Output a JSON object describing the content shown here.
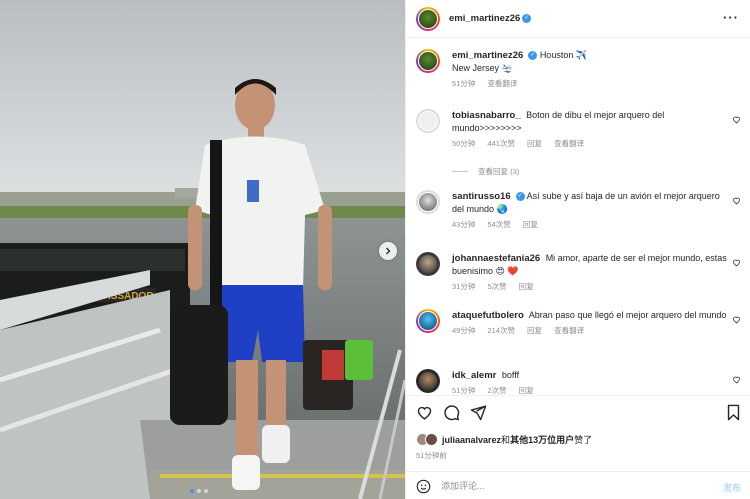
{
  "post": {
    "username": "emi_martinez26",
    "more_icon": "more-horizontal-icon"
  },
  "caption": {
    "username": "emi_martinez26",
    "line1": "Houston ✈️",
    "line2": "New Jersey 🛬",
    "time": "51分钟",
    "view_translation": "查看翻译"
  },
  "comments": [
    {
      "username": "tobiasnabarro_",
      "text": "Boton de dibu el mejor arquero del mundo>>>>>>>>",
      "time": "50分钟",
      "likes": "441次赞",
      "reply": "回复",
      "translate": "查看翻译",
      "view_replies": "查看回复 (3)"
    },
    {
      "username": "santirusso16",
      "verified": true,
      "text": "Así sube y así baja de un avión el mejor arquero del mundo 🌏",
      "time": "43分钟",
      "likes": "54次赞",
      "reply": "回复"
    },
    {
      "username": "johannaestefania26",
      "text": "Mi amor, aparte de ser el mejor mundo, estas buenisimo 😍 ❤️",
      "time": "31分钟",
      "likes": "5次赞",
      "reply": "回复"
    },
    {
      "username": "ataquefutbolero",
      "text": "Abran paso que llegó el mejor arquero del mundo",
      "time": "49分钟",
      "likes": "214次赞",
      "reply": "回复",
      "translate": "查看翻译"
    },
    {
      "username": "idk_alemr",
      "text": "bofff",
      "time": "51分钟",
      "likes": "2次赞",
      "reply": "回复"
    }
  ],
  "likes_line": {
    "user": "juliaanalvarez",
    "connector": "和",
    "others": "其他13万位用户",
    "suffix": "赞了"
  },
  "post_time": "51分钟前",
  "comment_box": {
    "placeholder": "添加评论...",
    "post_label": "发布",
    "emoji_icon": "smiley-icon"
  },
  "photo": {
    "bus_text": "MBASSADOR"
  },
  "colors": {
    "verified_blue": "#3897f0",
    "secondary_text": "#8e8e8e",
    "post_disabled": "#b2dffc"
  }
}
